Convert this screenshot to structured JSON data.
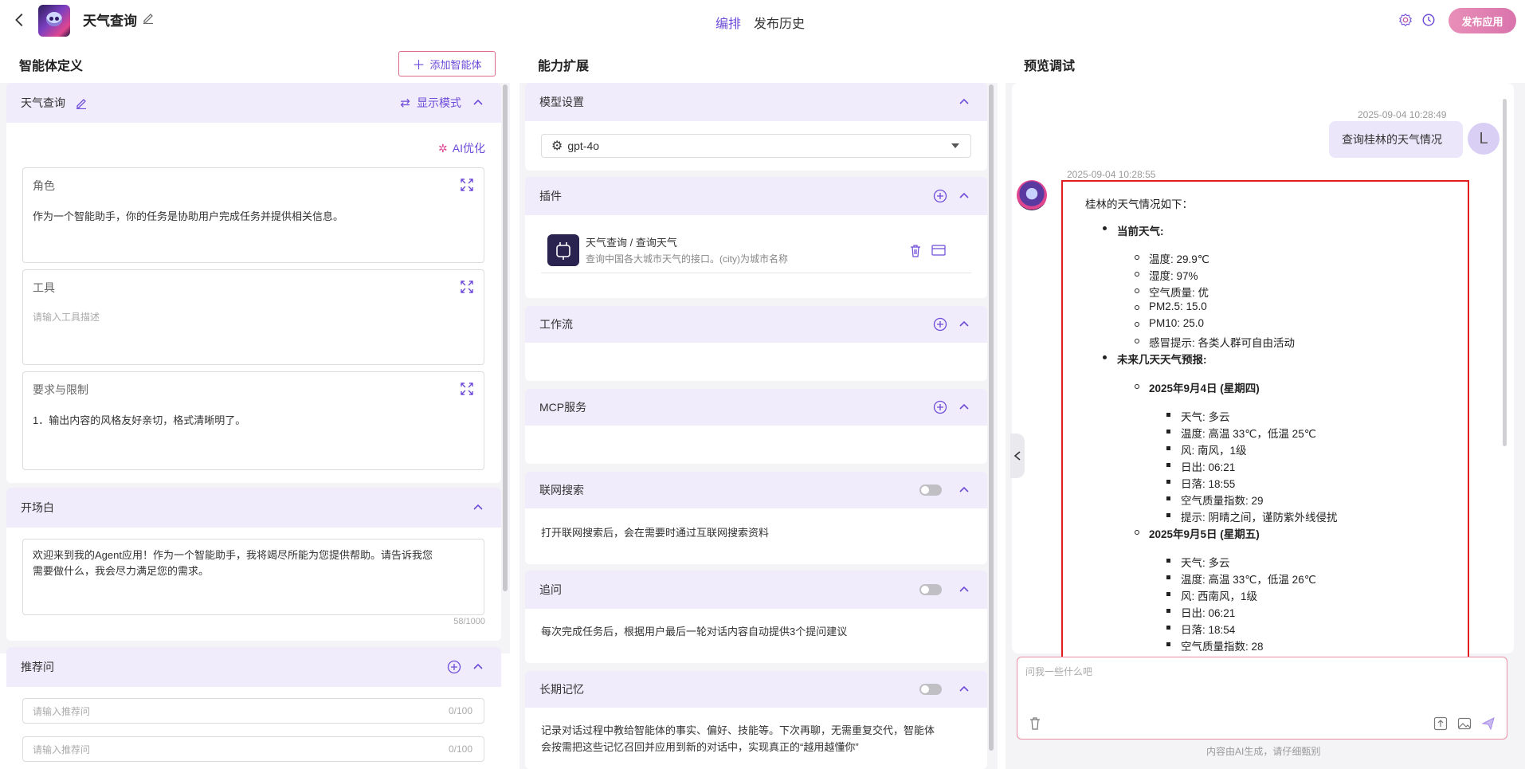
{
  "header": {
    "app_title": "天气查询",
    "tabs": [
      "编排",
      "发布历史"
    ],
    "publish_label": "发布应用"
  },
  "left": {
    "title": "智能体定义",
    "add_agent_label": "添加智能体",
    "agent_name": "天气查询",
    "display_mode_label": "显示模式",
    "ai_optimize_label": "AI优化",
    "role": {
      "label": "角色",
      "text": "作为一个智能助手，你的任务是协助用户完成任务并提供相关信息。"
    },
    "tools": {
      "label": "工具",
      "placeholder": "请输入工具描述"
    },
    "constraints": {
      "label": "要求与限制",
      "text": "1．输出内容的风格友好亲切，格式清晰明了。"
    },
    "opening": {
      "label": "开场白",
      "text_line1": "欢迎来到我的Agent应用！作为一个智能助手，我将竭尽所能为您提供帮助。请告诉我您",
      "text_line2": "需要做什么，我会尽力满足您的需求。",
      "count": "58/1000"
    },
    "suggestions": {
      "label": "推荐问",
      "placeholder": "请输入推荐问",
      "count": "0/100"
    }
  },
  "middle": {
    "title": "能力扩展",
    "model": {
      "label": "模型设置",
      "value": "gpt-4o"
    },
    "plugins": {
      "label": "插件",
      "item_title": "天气查询 / 查询天气",
      "item_desc": "查询中国各大城市天气的接口。(city)为城市名称"
    },
    "workflow": {
      "label": "工作流"
    },
    "mcp": {
      "label": "MCP服务"
    },
    "web_search": {
      "label": "联网搜索",
      "desc": "打开联网搜索后，会在需要时通过互联网搜索资料"
    },
    "follow_up": {
      "label": "追问",
      "desc": "每次完成任务后，根据用户最后一轮对话内容自动提供3个提问建议"
    },
    "memory": {
      "label": "长期记忆",
      "desc_line1": "记录对话过程中教给智能体的事实、偏好、技能等。下次再聊，无需重复交代，智能体",
      "desc_line2": "会按需把这些记忆召回并应用到新的对话中，实现真正的“越用越懂你”"
    }
  },
  "right": {
    "title": "预览调试",
    "user_time": "2025-09-04 10:28:49",
    "user_msg": "查询桂林的天气情况",
    "user_avatar": "L",
    "bot_time": "2025-09-04 10:28:55",
    "answer": {
      "intro": "桂林的天气情况如下：",
      "current_title": "当前天气:",
      "current": [
        "温度: 29.9℃",
        "湿度: 97%",
        "空气质量: 优",
        "PM2.5: 15.0",
        "PM10: 25.0",
        "感冒提示: 各类人群可自由活动"
      ],
      "forecast_title": "未来几天天气预报:",
      "day1_title": "2025年9月4日 (星期四)",
      "day1": [
        "天气: 多云",
        "温度: 高温 33℃，低温 25℃",
        "风: 南风，1级",
        "日出: 06:21",
        "日落: 18:55",
        "空气质量指数: 29",
        "提示: 阴晴之间，谨防紫外线侵扰"
      ],
      "day2_title": "2025年9月5日 (星期五)",
      "day2": [
        "天气: 多云",
        "温度: 高温 33℃，低温 26℃",
        "风: 西南风，1级",
        "日出: 06:21",
        "日落: 18:54",
        "空气质量指数: 28"
      ]
    },
    "input_placeholder": "问我一些什么吧",
    "footer": "内容由AI生成，请仔细甄别"
  },
  "colors": {
    "accent": "#6d4bd8",
    "header_bg": "#f0ecfb",
    "highlight": "#e02020"
  }
}
